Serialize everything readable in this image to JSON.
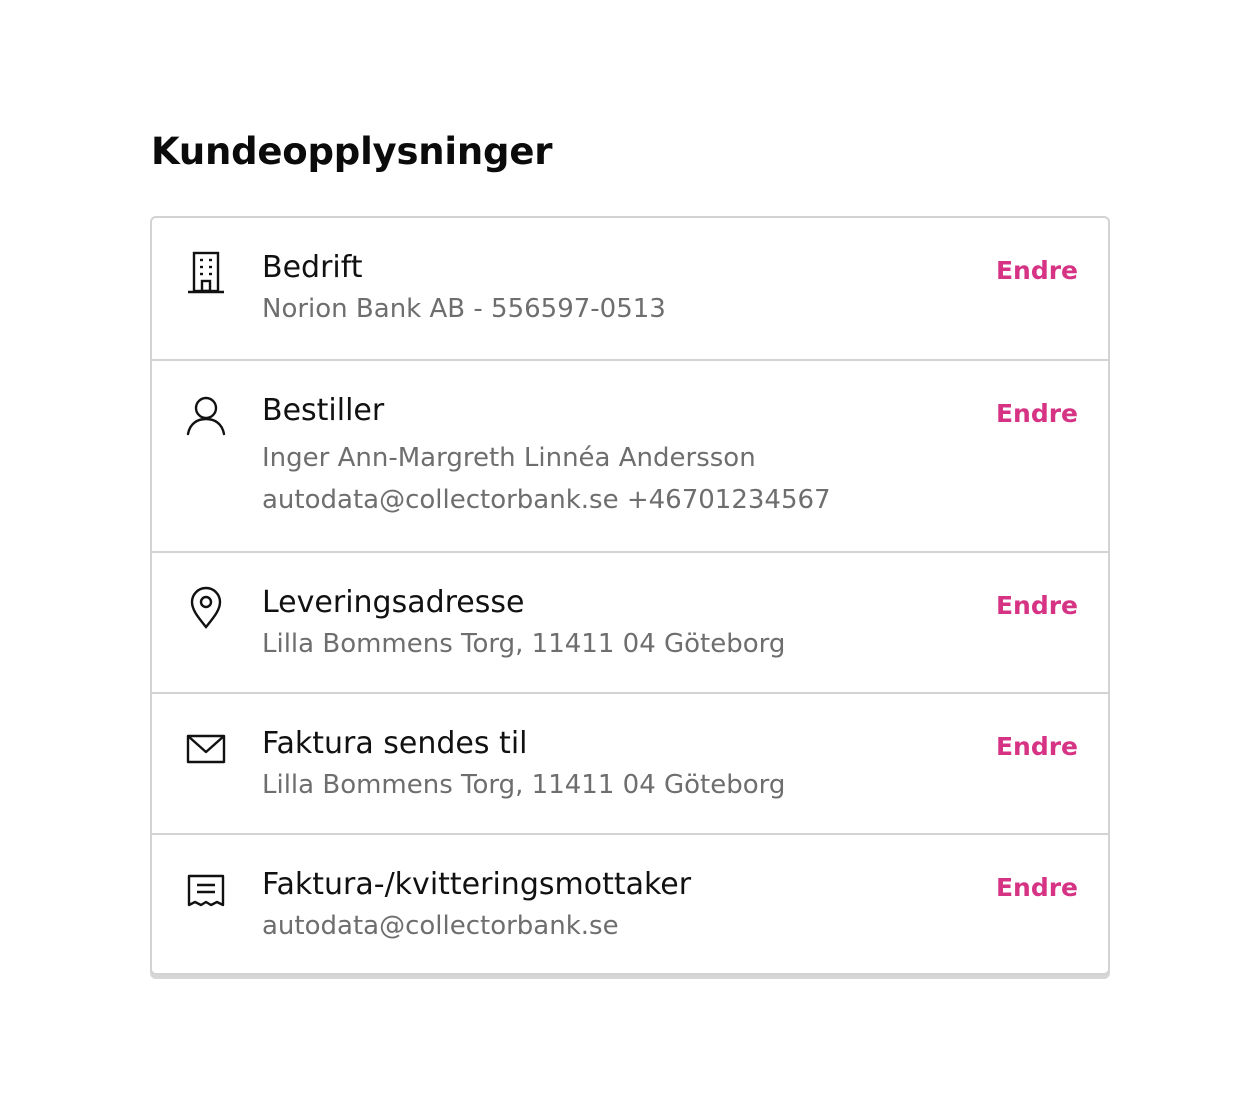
{
  "page": {
    "title": "Kundeopplysninger"
  },
  "colors": {
    "accent": "#d63384",
    "label": "#111111",
    "value": "#6e6e6e",
    "border": "#d3d3d3"
  },
  "sections": [
    {
      "icon": "building-icon",
      "label": "Bedrift",
      "lines": [
        "Norion Bank AB - 556597-0513"
      ],
      "action": "Endre"
    },
    {
      "icon": "user-icon",
      "label": "Bestiller",
      "lines": [
        "Inger Ann-Margreth Linnéa Andersson",
        "autodata@collectorbank.se +46701234567"
      ],
      "action": "Endre"
    },
    {
      "icon": "location-pin-icon",
      "label": "Leveringsadresse",
      "lines": [
        "Lilla Bommens Torg, 11411 04 Göteborg"
      ],
      "action": "Endre"
    },
    {
      "icon": "envelope-icon",
      "label": "Faktura sendes til",
      "lines": [
        "Lilla Bommens Torg, 11411 04 Göteborg"
      ],
      "action": "Endre"
    },
    {
      "icon": "receipt-icon",
      "label": "Faktura-/kvitteringsmottaker",
      "lines": [
        "autodata@collectorbank.se"
      ],
      "action": "Endre"
    }
  ]
}
